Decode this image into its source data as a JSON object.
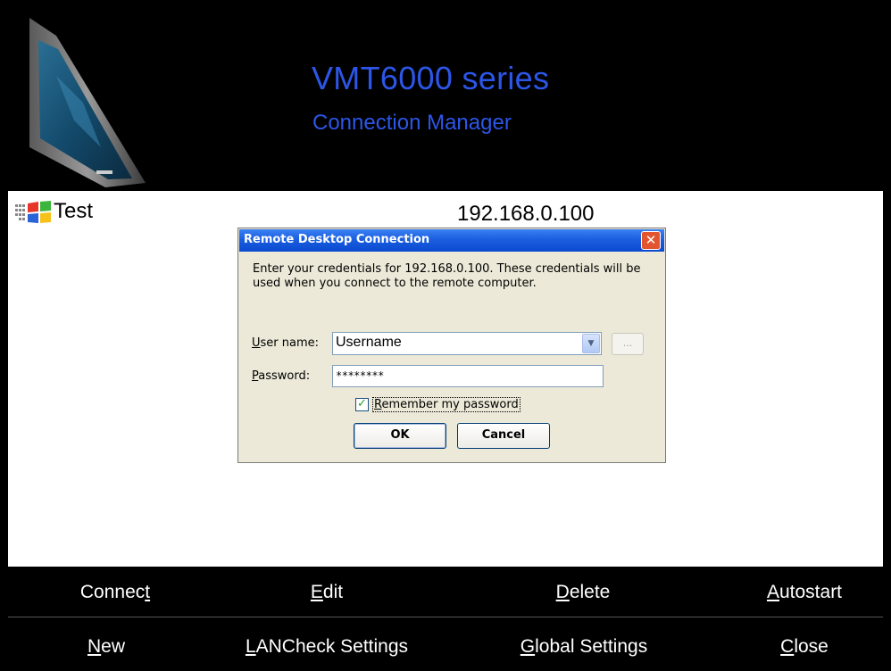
{
  "header": {
    "title": "VMT6000 series",
    "subtitle": "Connection Manager"
  },
  "connections": [
    {
      "name": "Test",
      "address": "192.168.0.100",
      "icon": "windows-flag-icon"
    }
  ],
  "dialog": {
    "title": "Remote Desktop Connection",
    "close_icon": "close-icon",
    "message": "Enter your credentials for 192.168.0.100. These credentials will be used when you connect to the remote computer.",
    "user_name_label_u": "U",
    "user_name_label_rest": "ser name:",
    "user_name_value": "Username",
    "browse_label": "...",
    "password_label_u": "P",
    "password_label_rest": "assword:",
    "password_value": "********",
    "remember_checked": true,
    "remember_label_u": "R",
    "remember_label_rest": "emember my password",
    "ok_label": "OK",
    "cancel_label": "Cancel"
  },
  "bottom_bar": {
    "row1": [
      {
        "pre": "Connec",
        "u": "t",
        "post": ""
      },
      {
        "pre": "",
        "u": "E",
        "post": "dit"
      },
      {
        "pre": "",
        "u": "D",
        "post": "elete"
      },
      {
        "pre": "",
        "u": "A",
        "post": "utostart"
      }
    ],
    "row2": [
      {
        "pre": "",
        "u": "N",
        "post": "ew"
      },
      {
        "pre": "",
        "u": "L",
        "post": "ANCheck Settings"
      },
      {
        "pre": "",
        "u": "G",
        "post": "lobal Settings"
      },
      {
        "pre": "",
        "u": "C",
        "post": "lose"
      }
    ]
  },
  "colors": {
    "header_bg": "#000000",
    "header_text": "#2c56e8",
    "titlebar": "#1b5fe0",
    "dialog_bg": "#ece9d8"
  }
}
